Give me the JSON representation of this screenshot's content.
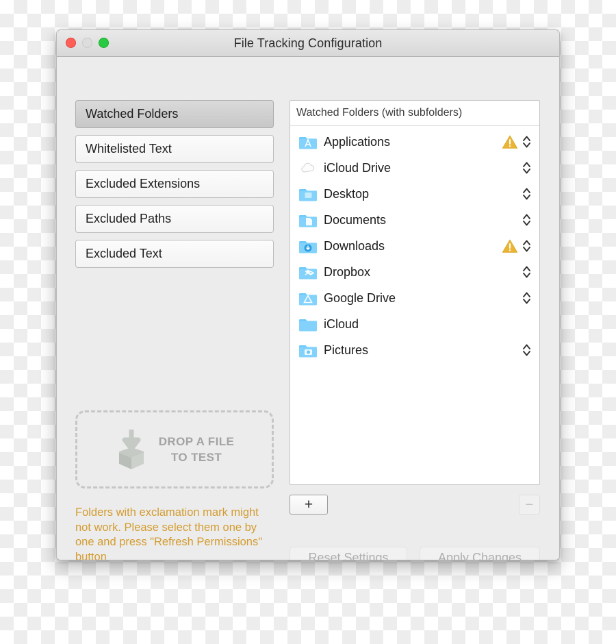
{
  "window": {
    "title": "File Tracking Configuration",
    "traffic_lights": [
      {
        "name": "close",
        "color": "#ff5f57"
      },
      {
        "name": "minimize",
        "color": "#dddddd"
      },
      {
        "name": "zoom",
        "color": "#28ca42"
      }
    ]
  },
  "sidebar": {
    "tabs": [
      {
        "label": "Watched Folders",
        "selected": true
      },
      {
        "label": "Whitelisted Text",
        "selected": false
      },
      {
        "label": "Excluded Extensions",
        "selected": false
      },
      {
        "label": "Excluded Paths",
        "selected": false
      },
      {
        "label": "Excluded Text",
        "selected": false
      }
    ]
  },
  "dropzone": {
    "icon": "drop-box-icon",
    "line1": "DROP A FILE",
    "line2": "TO TEST"
  },
  "warning_note": {
    "text": "Folders with exclamation mark might not work. Please select them one by one and press \"Refresh Permissions\" button",
    "color": "#d39c30"
  },
  "list": {
    "header": "Watched Folders (with subfolders)",
    "rows": [
      {
        "label": "Applications",
        "icon": "folder-applications-icon",
        "warning": true,
        "stepper": true
      },
      {
        "label": "iCloud Drive",
        "icon": "cloud-icon",
        "warning": false,
        "stepper": true
      },
      {
        "label": "Desktop",
        "icon": "folder-desktop-icon",
        "warning": false,
        "stepper": true
      },
      {
        "label": "Documents",
        "icon": "folder-documents-icon",
        "warning": false,
        "stepper": true
      },
      {
        "label": "Downloads",
        "icon": "folder-downloads-icon",
        "warning": true,
        "stepper": true
      },
      {
        "label": "Dropbox",
        "icon": "folder-dropbox-icon",
        "warning": false,
        "stepper": true
      },
      {
        "label": "Google Drive",
        "icon": "folder-google-drive-icon",
        "warning": false,
        "stepper": true
      },
      {
        "label": "iCloud",
        "icon": "folder-plain-icon",
        "warning": false,
        "stepper": false
      },
      {
        "label": "Pictures",
        "icon": "folder-pictures-icon",
        "warning": false,
        "stepper": true
      }
    ]
  },
  "controls": {
    "add_label": "+",
    "remove_label": "−",
    "reset_label": "Reset Settings",
    "apply_label": "Apply Changes"
  },
  "colors": {
    "warning_triangle": "#eab436",
    "folder_blue": "#6ecafc",
    "window_bg": "#ececec"
  }
}
